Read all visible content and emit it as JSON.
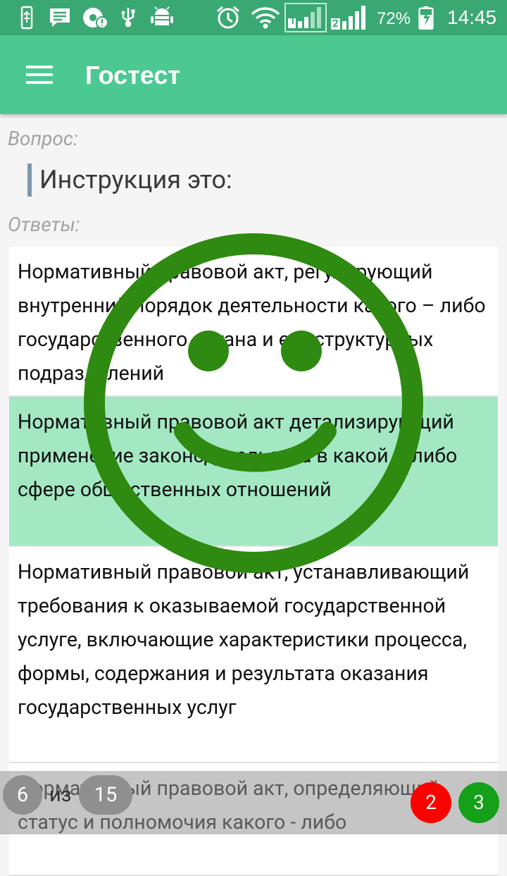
{
  "status_bar": {
    "battery_percent": "72%",
    "time": "14:45",
    "sim1_label": "1",
    "sim2_label": "2",
    "icons": [
      "usb-icon",
      "message-icon",
      "chrome-alert-icon",
      "usb-debug-icon",
      "android-icon",
      "alarm-icon",
      "wifi-icon",
      "signal-sim1-icon",
      "signal-sim2-icon",
      "battery-charging-icon"
    ]
  },
  "app_bar": {
    "title": "Гостест",
    "menu_icon": "hamburger-menu-icon"
  },
  "question": {
    "label": "Вопрос:",
    "text": "Инструкция это:"
  },
  "answers": {
    "label": "Ответы:",
    "items": [
      {
        "text": "Нормативный правовой акт, регулирующий внутренний порядок деятельности какого – либо государственного органа и его структурных подразделений",
        "selected": false
      },
      {
        "text": "Нормативный правовой акт детализирующий применение законодательства в какой – либо сфере общественных отношений",
        "selected": true
      },
      {
        "text": "Нормативный правовой акт, устанавливающий требования к оказываемой государственной услуге, включающие характеристики процесса, формы, содержания и результата оказания государственных услуг",
        "selected": false
      },
      {
        "text": "Нормативный правовой акт, определяющий статус и полномочия какого - либо",
        "selected": false
      }
    ]
  },
  "feedback": {
    "icon": "smiley-correct-icon",
    "color": "#2e8a10"
  },
  "progress": {
    "current": "6",
    "of_label": "из",
    "total": "15",
    "wrong_count": "2",
    "right_count": "3",
    "wrong_color": "#ff0000",
    "right_color": "#14a018"
  }
}
